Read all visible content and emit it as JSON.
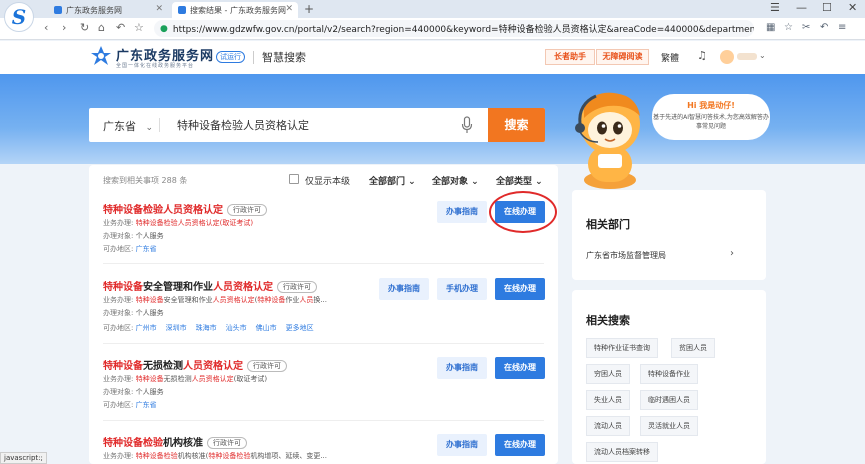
{
  "browser": {
    "tabs": [
      {
        "label": "广东政务服务网"
      },
      {
        "label": "搜索结果 - 广东政务服务网"
      }
    ],
    "url": "https://www.gdzwfw.gov.cn/portal/v2/search?region=440000&keyword=特种设备检验人员资格认定&areaCode=440000&departmen"
  },
  "site": {
    "name": "广东政务服务网",
    "slogan": "全国一体化在线政务服务平台",
    "trial_badge": "试运行",
    "section": "智慧搜索",
    "elder_label": "长者助手",
    "barrier_label": "无障碍阅读",
    "traditional_label": "繁體"
  },
  "search": {
    "region": "广东省",
    "keyword": "特种设备检验人员资格认定",
    "button": "搜索"
  },
  "mascot": {
    "title": "Hi 我是动仔!",
    "text": "基于先进的AI智慧问答技术,为您高效解答办事常见问题"
  },
  "filters": {
    "count_text": "搜索到相关事项 288 条",
    "checkbox_label": "仅显示本级",
    "dropdowns": [
      "全部部门",
      "全部对象",
      "全部类型"
    ]
  },
  "labels": {
    "business": "业务办理:",
    "target": "办理对象:",
    "area": "可办地区:",
    "guide": "办事指南",
    "online": "在线办理",
    "mobile": "手机办理"
  },
  "results": [
    {
      "title": "特种设备检验人员资格认定",
      "tag": "行政许可",
      "business": "特种设备检验人员资格认定(取证考试)",
      "target": "个人服务",
      "areas": [
        "广东省"
      ]
    },
    {
      "title_parts": [
        "特种设备",
        "安全管理和作业",
        "人员资格认定"
      ],
      "tag": "行政许可",
      "business_parts": [
        "特种设备",
        "安全管理和作业",
        "人员资格认定",
        "(",
        "特种设备",
        "作业",
        "人员",
        "换..."
      ],
      "target": "个人服务",
      "areas": [
        "广州市",
        "深圳市",
        "珠海市",
        "汕头市",
        "佛山市",
        "更多地区"
      ]
    },
    {
      "title_parts": [
        "特种设备",
        "无损检测",
        "人员资格认定"
      ],
      "tag": "行政许可",
      "business_parts": [
        "特种设备",
        "无损检测",
        "人员资格认定",
        "(取证考试)"
      ],
      "target": "个人服务",
      "areas": [
        "广东省"
      ]
    },
    {
      "title_parts": [
        "特种设备检验",
        "机构核准"
      ],
      "tag": "行政许可",
      "business_parts": [
        "特种设备检验",
        "机构核准(",
        "特种设备检验",
        "机构增项、延续、变更..."
      ]
    }
  ],
  "side": {
    "dept_title": "相关部门",
    "dept": "广东省市场监督管理局",
    "related_title": "相关搜索",
    "chips": [
      "特种作业证书查询",
      "贫困人员",
      "穷困人员",
      "特种设备作业",
      "失业人员",
      "临时遇困人员",
      "流动人员",
      "灵活就业人员",
      "流动人员档案转移"
    ]
  },
  "statusbar": "javascript:;"
}
